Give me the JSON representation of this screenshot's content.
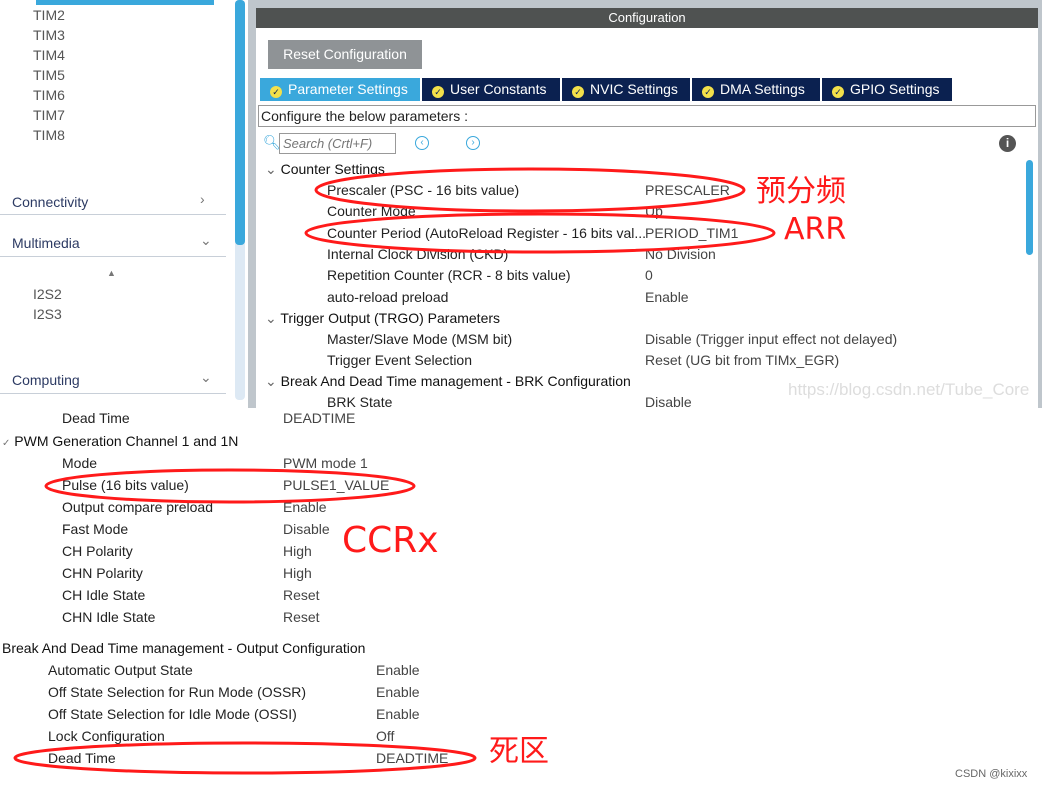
{
  "sidebar": {
    "timers": [
      "TIM2",
      "TIM3",
      "TIM4",
      "TIM5",
      "TIM6",
      "TIM7",
      "TIM8"
    ],
    "categories": {
      "connectivity": "Connectivity",
      "multimedia": "Multimedia",
      "computing": "Computing"
    },
    "multimedia_items": [
      "I2S2",
      "I2S3"
    ]
  },
  "config": {
    "header": "Configuration",
    "reset_label": "Reset Configuration",
    "tabs": [
      "Parameter Settings",
      "User Constants",
      "NVIC Settings",
      "DMA Settings",
      "GPIO Settings"
    ],
    "active_tab": "Parameter Settings",
    "title": "Configure the below parameters :",
    "search_placeholder": "Search (Crtl+F)",
    "groups": {
      "counter": "Counter Settings",
      "trgo": "Trigger Output (TRGO) Parameters",
      "brk": "Break And Dead Time management - BRK Configuration"
    },
    "counter_rows": [
      {
        "label": "Prescaler (PSC - 16 bits value)",
        "value": "PRESCALER"
      },
      {
        "label": "Counter Mode",
        "value": "Up"
      },
      {
        "label": "Counter Period (AutoReload Register - 16 bits val...",
        "value": "PERIOD_TIM1"
      },
      {
        "label": "Internal Clock Division (CKD)",
        "value": "No Division"
      },
      {
        "label": "Repetition Counter (RCR - 8 bits value)",
        "value": "0"
      },
      {
        "label": "auto-reload preload",
        "value": "Enable"
      }
    ],
    "trgo_rows": [
      {
        "label": "Master/Slave Mode (MSM bit)",
        "value": "Disable (Trigger input effect not delayed)"
      },
      {
        "label": "Trigger Event Selection",
        "value": "Reset (UG bit from TIMx_EGR)"
      }
    ],
    "brk_rows": [
      {
        "label": "BRK State",
        "value": "Disable"
      }
    ]
  },
  "lower": {
    "cut_row": {
      "label": "Dead Time",
      "value": "DEADTIME"
    },
    "pwm_group": "PWM Generation Channel 1 and 1N",
    "pwm_rows": [
      {
        "label": "Mode",
        "value": "PWM mode 1"
      },
      {
        "label": "Pulse (16 bits value)",
        "value": "PULSE1_VALUE"
      },
      {
        "label": "Output compare preload",
        "value": "Enable"
      },
      {
        "label": "Fast Mode",
        "value": "Disable"
      },
      {
        "label": "CH Polarity",
        "value": "High"
      },
      {
        "label": "CHN Polarity",
        "value": "High"
      },
      {
        "label": "CH Idle State",
        "value": "Reset"
      },
      {
        "label": "CHN Idle State",
        "value": "Reset"
      }
    ],
    "out_group": "Break And Dead Time management - Output Configuration",
    "out_rows": [
      {
        "label": "Automatic Output State",
        "value": "Enable"
      },
      {
        "label": "Off State Selection for Run Mode (OSSR)",
        "value": "Enable"
      },
      {
        "label": "Off State Selection for Idle Mode (OSSI)",
        "value": "Enable"
      },
      {
        "label": "Lock Configuration",
        "value": "Off"
      },
      {
        "label": "Dead Time",
        "value": "DEADTIME"
      }
    ],
    "next_group_cut": "PWM Generation Channel 1 and 1N"
  },
  "annotations": {
    "prescaler": "预分频",
    "arr": "ARR",
    "ccr": "CCRx",
    "deadtime": "死区",
    "color": "#ff1a1a"
  },
  "watermark": "https://blog.csdn.net/Tube_Core",
  "credit": "CSDN @kixixx"
}
